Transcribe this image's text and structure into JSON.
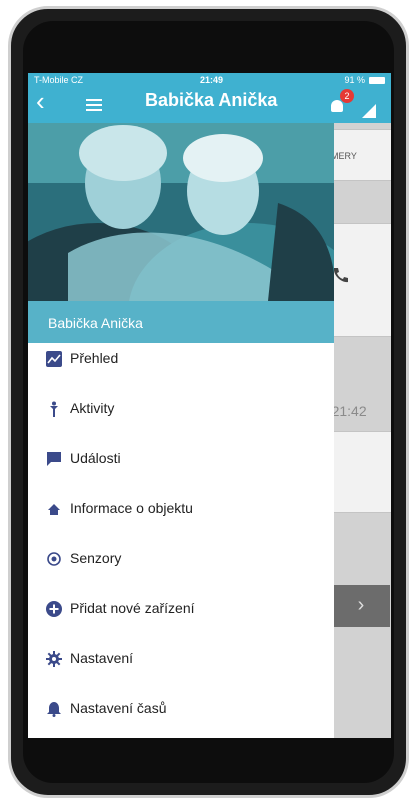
{
  "status_bar": {
    "carrier": "T-Mobile CZ",
    "time": "21:49",
    "battery": "91 %"
  },
  "app_bar": {
    "title": "Babička Anička",
    "notification_count": "2",
    "colors": {
      "bar": "#3fb1d0",
      "badge": "#e53935"
    }
  },
  "background": {
    "button_text_fragment": "MERY",
    "timestamp_fragment": "2. 21:42"
  },
  "drawer": {
    "name": "Babička Anička",
    "items": [
      {
        "icon": "chart-icon",
        "label": "Přehled"
      },
      {
        "icon": "activity-icon",
        "label": "Aktivity"
      },
      {
        "icon": "message-icon",
        "label": "Události"
      },
      {
        "icon": "home-icon",
        "label": "Informace o objektu"
      },
      {
        "icon": "sensor-icon",
        "label": "Senzory"
      },
      {
        "icon": "plus-circle-icon",
        "label": "Přidat nové zařízení"
      },
      {
        "icon": "gear-icon",
        "label": "Nastavení"
      },
      {
        "icon": "bell-icon",
        "label": "Nastavení časů"
      }
    ],
    "colors": {
      "namebar": "#57b2c8",
      "icon": "#3b4a8a"
    }
  }
}
